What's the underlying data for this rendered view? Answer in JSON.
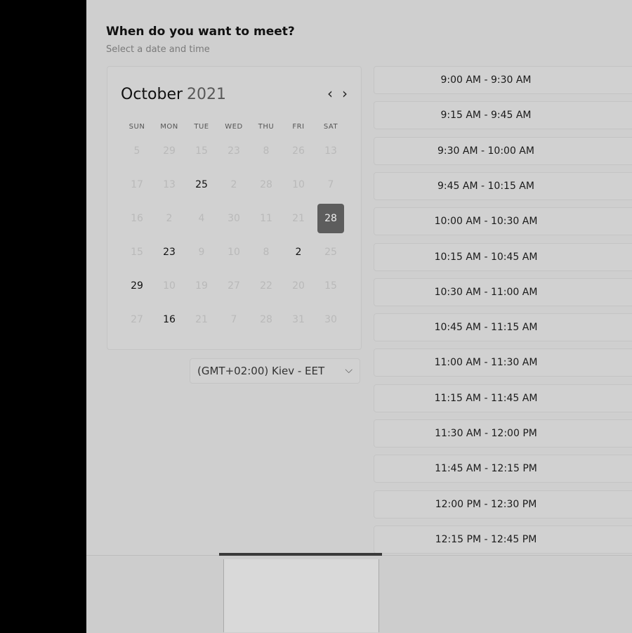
{
  "header": {
    "title": ""
  },
  "section": {
    "title": "When do you want to meet?",
    "subtitle": "Select a date and time"
  },
  "calendar": {
    "month": "October",
    "year": "2021",
    "prev_icon": "chevron-left-icon",
    "next_icon": "chevron-right-icon",
    "weekdays": [
      "SUN",
      "MON",
      "TUE",
      "WED",
      "THU",
      "FRI",
      "SAT"
    ],
    "days": [
      {
        "label": "5",
        "available": false
      },
      {
        "label": "29",
        "available": false
      },
      {
        "label": "15",
        "available": false
      },
      {
        "label": "23",
        "available": false
      },
      {
        "label": "8",
        "available": false
      },
      {
        "label": "26",
        "available": false
      },
      {
        "label": "13",
        "available": false
      },
      {
        "label": "17",
        "available": false
      },
      {
        "label": "13",
        "available": false
      },
      {
        "label": "25",
        "available": true
      },
      {
        "label": "2",
        "available": false
      },
      {
        "label": "28",
        "available": false
      },
      {
        "label": "10",
        "available": false
      },
      {
        "label": "7",
        "available": false
      },
      {
        "label": "16",
        "available": false
      },
      {
        "label": "2",
        "available": false
      },
      {
        "label": "4",
        "available": false
      },
      {
        "label": "30",
        "available": false
      },
      {
        "label": "11",
        "available": false
      },
      {
        "label": "21",
        "available": false
      },
      {
        "label": "28",
        "available": true,
        "selected": true
      },
      {
        "label": "15",
        "available": false
      },
      {
        "label": "23",
        "available": true
      },
      {
        "label": "9",
        "available": false
      },
      {
        "label": "10",
        "available": false
      },
      {
        "label": "8",
        "available": false
      },
      {
        "label": "2",
        "available": true
      },
      {
        "label": "25",
        "available": false
      },
      {
        "label": "29",
        "available": true
      },
      {
        "label": "10",
        "available": false
      },
      {
        "label": "19",
        "available": false
      },
      {
        "label": "27",
        "available": false
      },
      {
        "label": "22",
        "available": false
      },
      {
        "label": "20",
        "available": false
      },
      {
        "label": "15",
        "available": false
      },
      {
        "label": "27",
        "available": false
      },
      {
        "label": "16",
        "available": true
      },
      {
        "label": "21",
        "available": false
      },
      {
        "label": "7",
        "available": false
      },
      {
        "label": "28",
        "available": false
      },
      {
        "label": "31",
        "available": false
      },
      {
        "label": "30",
        "available": false
      }
    ]
  },
  "timezone": {
    "value": "(GMT+02:00) Kiev - EET",
    "icon": "chevron-down-icon"
  },
  "time_slots": [
    "9:00 AM - 9:30 AM",
    "9:15 AM - 9:45 AM",
    "9:30 AM - 10:00 AM",
    "9:45 AM - 10:15 AM",
    "10:00 AM - 10:30 AM",
    "10:15 AM - 10:45 AM",
    "10:30 AM - 11:00 AM",
    "10:45 AM - 11:15 AM",
    "11:00 AM - 11:30 AM",
    "11:15 AM - 11:45 AM",
    "11:30 AM - 12:00 PM",
    "11:45 AM - 12:15 PM",
    "12:00 PM - 12:30 PM",
    "12:15 PM - 12:45 PM"
  ]
}
